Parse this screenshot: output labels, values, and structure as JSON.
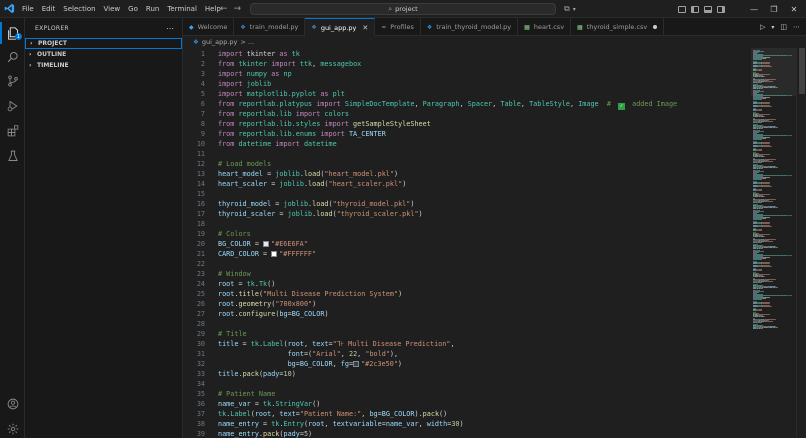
{
  "menu": [
    "File",
    "Edit",
    "Selection",
    "View",
    "Go",
    "Run",
    "Terminal",
    "Help"
  ],
  "search": {
    "text": "project"
  },
  "sidebar": {
    "title": "EXPLORER",
    "sections": [
      {
        "label": "PROJECT",
        "focused": true
      },
      {
        "label": "OUTLINE",
        "focused": false
      },
      {
        "label": "TIMELINE",
        "focused": false
      }
    ]
  },
  "tabs": [
    {
      "label": "Welcome",
      "icon": "vscode-icon",
      "color": "#3aa0f0",
      "active": false,
      "state": ""
    },
    {
      "label": "train_model.py",
      "icon": "python-icon",
      "color": "#3d8fd1",
      "active": false,
      "state": ""
    },
    {
      "label": "gui_app.py",
      "icon": "python-icon",
      "color": "#3d8fd1",
      "active": true,
      "state": "close"
    },
    {
      "label": "Profiles",
      "icon": "profiles-icon",
      "color": "#9d9d9d",
      "active": false,
      "state": ""
    },
    {
      "label": "train_thyroid_model.py",
      "icon": "python-icon",
      "color": "#3d8fd1",
      "active": false,
      "state": ""
    },
    {
      "label": "heart.csv",
      "icon": "csv-icon",
      "color": "#89d185",
      "active": false,
      "state": ""
    },
    {
      "label": "thyroid_simple.csv",
      "icon": "csv-icon",
      "color": "#89d185",
      "active": false,
      "state": "dirty"
    }
  ],
  "breadcrumb": {
    "file": "gui_app.py",
    "rest": "> ..."
  },
  "colors": {
    "accent": "#0078d4",
    "editor_bg": "#1f1f1f",
    "sidebar_bg": "#181818"
  },
  "code": [
    [
      [
        "k",
        "import"
      ],
      [
        "w",
        " tkinter "
      ],
      [
        "k",
        "as"
      ],
      [
        "t",
        " tk"
      ]
    ],
    [
      [
        "k",
        "from"
      ],
      [
        "t",
        " tkinter "
      ],
      [
        "k",
        "import"
      ],
      [
        "t",
        " ttk"
      ],
      [
        "p",
        ", "
      ],
      [
        "t",
        "messagebox"
      ]
    ],
    [
      [
        "k",
        "import"
      ],
      [
        "t",
        " numpy "
      ],
      [
        "k",
        "as"
      ],
      [
        "t",
        " np"
      ]
    ],
    [
      [
        "k",
        "import"
      ],
      [
        "t",
        " joblib"
      ]
    ],
    [
      [
        "k",
        "import"
      ],
      [
        "t",
        " matplotlib.pyplot "
      ],
      [
        "k",
        "as"
      ],
      [
        "t",
        " plt"
      ]
    ],
    [
      [
        "k",
        "from"
      ],
      [
        "t",
        " reportlab.platypus "
      ],
      [
        "k",
        "import"
      ],
      [
        "t",
        " SimpleDocTemplate"
      ],
      [
        "p",
        ", "
      ],
      [
        "t",
        "Paragraph"
      ],
      [
        "p",
        ", "
      ],
      [
        "t",
        "Spacer"
      ],
      [
        "p",
        ", "
      ],
      [
        "t",
        "Table"
      ],
      [
        "p",
        ", "
      ],
      [
        "t",
        "TableStyle"
      ],
      [
        "p",
        ", "
      ],
      [
        "t",
        "Image"
      ],
      [
        "c",
        "  # "
      ],
      [
        "chk",
        "✓"
      ],
      [
        "c",
        " added Image"
      ]
    ],
    [
      [
        "k",
        "from"
      ],
      [
        "t",
        " reportlab.lib "
      ],
      [
        "k",
        "import"
      ],
      [
        "t",
        " colors"
      ]
    ],
    [
      [
        "k",
        "from"
      ],
      [
        "t",
        " reportlab.lib.styles "
      ],
      [
        "k",
        "import"
      ],
      [
        "f",
        " getSampleStyleSheet"
      ]
    ],
    [
      [
        "k",
        "from"
      ],
      [
        "t",
        " reportlab.lib.enums "
      ],
      [
        "k",
        "import"
      ],
      [
        "v",
        " TA_CENTER"
      ]
    ],
    [
      [
        "k",
        "from"
      ],
      [
        "t",
        " datetime "
      ],
      [
        "k",
        "import"
      ],
      [
        "t",
        " datetime"
      ]
    ],
    [],
    [
      [
        "c",
        "# Load models"
      ]
    ],
    [
      [
        "v",
        "heart_model"
      ],
      [
        "p",
        " = "
      ],
      [
        "t",
        "joblib"
      ],
      [
        "p",
        "."
      ],
      [
        "f",
        "load"
      ],
      [
        "p",
        "("
      ],
      [
        "s",
        "\"heart_model.pkl\""
      ],
      [
        "p",
        ")"
      ]
    ],
    [
      [
        "v",
        "heart_scaler"
      ],
      [
        "p",
        " = "
      ],
      [
        "t",
        "joblib"
      ],
      [
        "p",
        "."
      ],
      [
        "f",
        "load"
      ],
      [
        "p",
        "("
      ],
      [
        "s",
        "\"heart_scaler.pkl\""
      ],
      [
        "p",
        ")"
      ]
    ],
    [],
    [
      [
        "v",
        "thyroid_model"
      ],
      [
        "p",
        " = "
      ],
      [
        "t",
        "joblib"
      ],
      [
        "p",
        "."
      ],
      [
        "f",
        "load"
      ],
      [
        "p",
        "("
      ],
      [
        "s",
        "\"thyroid_model.pkl\""
      ],
      [
        "p",
        ")"
      ]
    ],
    [
      [
        "v",
        "thyroid_scaler"
      ],
      [
        "p",
        " = "
      ],
      [
        "t",
        "joblib"
      ],
      [
        "p",
        "."
      ],
      [
        "f",
        "load"
      ],
      [
        "p",
        "("
      ],
      [
        "s",
        "\"thyroid_scaler.pkl\""
      ],
      [
        "p",
        ")"
      ]
    ],
    [],
    [
      [
        "c",
        "# Colors"
      ]
    ],
    [
      [
        "v",
        "BG_COLOR"
      ],
      [
        "p",
        " = "
      ],
      [
        "sw",
        "#E6E6FA"
      ],
      [
        "s",
        "\"#E6E6FA\""
      ]
    ],
    [
      [
        "v",
        "CARD_COLOR"
      ],
      [
        "p",
        " = "
      ],
      [
        "sw",
        "#FFFFFF"
      ],
      [
        "s",
        "\"#FFFFFF\""
      ]
    ],
    [],
    [
      [
        "c",
        "# Window"
      ]
    ],
    [
      [
        "v",
        "root"
      ],
      [
        "p",
        " = "
      ],
      [
        "t",
        "tk"
      ],
      [
        "p",
        "."
      ],
      [
        "t",
        "Tk"
      ],
      [
        "p",
        "()"
      ]
    ],
    [
      [
        "v",
        "root"
      ],
      [
        "p",
        "."
      ],
      [
        "f",
        "title"
      ],
      [
        "p",
        "("
      ],
      [
        "s",
        "\"Multi Disease Prediction System\""
      ],
      [
        "p",
        ")"
      ]
    ],
    [
      [
        "v",
        "root"
      ],
      [
        "p",
        "."
      ],
      [
        "f",
        "geometry"
      ],
      [
        "p",
        "("
      ],
      [
        "s",
        "\"700x800\""
      ],
      [
        "p",
        ")"
      ]
    ],
    [
      [
        "v",
        "root"
      ],
      [
        "p",
        "."
      ],
      [
        "f",
        "configure"
      ],
      [
        "p",
        "("
      ],
      [
        "v",
        "bg"
      ],
      [
        "p",
        "="
      ],
      [
        "v",
        "BG_COLOR"
      ],
      [
        "p",
        ")"
      ]
    ],
    [],
    [
      [
        "c",
        "# Title"
      ]
    ],
    [
      [
        "v",
        "title"
      ],
      [
        "p",
        " = "
      ],
      [
        "t",
        "tk"
      ],
      [
        "p",
        "."
      ],
      [
        "t",
        "Label"
      ],
      [
        "p",
        "("
      ],
      [
        "v",
        "root"
      ],
      [
        "p",
        ", "
      ],
      [
        "v",
        "text"
      ],
      [
        "p",
        "="
      ],
      [
        "s",
        "\"⅂⊦ Multi Disease Prediction\""
      ],
      [
        "p",
        ","
      ]
    ],
    [
      [
        "w",
        "                 "
      ],
      [
        "v",
        "font"
      ],
      [
        "p",
        "=("
      ],
      [
        "s",
        "\"Arial\""
      ],
      [
        "p",
        ", "
      ],
      [
        "n",
        "22"
      ],
      [
        "p",
        ", "
      ],
      [
        "s",
        "\"bold\""
      ],
      [
        "p",
        "),"
      ]
    ],
    [
      [
        "w",
        "                 "
      ],
      [
        "v",
        "bg"
      ],
      [
        "p",
        "="
      ],
      [
        "v",
        "BG_COLOR"
      ],
      [
        "p",
        ", "
      ],
      [
        "v",
        "fg"
      ],
      [
        "p",
        "="
      ],
      [
        "sw",
        "#2c3e50"
      ],
      [
        "s",
        "\"#2c3e50\""
      ],
      [
        "p",
        ")"
      ]
    ],
    [
      [
        "v",
        "title"
      ],
      [
        "p",
        "."
      ],
      [
        "f",
        "pack"
      ],
      [
        "p",
        "("
      ],
      [
        "v",
        "pady"
      ],
      [
        "p",
        "="
      ],
      [
        "n",
        "10"
      ],
      [
        "p",
        ")"
      ]
    ],
    [],
    [
      [
        "c",
        "# Patient Name"
      ]
    ],
    [
      [
        "v",
        "name_var"
      ],
      [
        "p",
        " = "
      ],
      [
        "t",
        "tk"
      ],
      [
        "p",
        "."
      ],
      [
        "t",
        "StringVar"
      ],
      [
        "p",
        "()"
      ]
    ],
    [
      [
        "t",
        "tk"
      ],
      [
        "p",
        "."
      ],
      [
        "t",
        "Label"
      ],
      [
        "p",
        "("
      ],
      [
        "v",
        "root"
      ],
      [
        "p",
        ", "
      ],
      [
        "v",
        "text"
      ],
      [
        "p",
        "="
      ],
      [
        "s",
        "\"Patient Name:\""
      ],
      [
        "p",
        ", "
      ],
      [
        "v",
        "bg"
      ],
      [
        "p",
        "="
      ],
      [
        "v",
        "BG_COLOR"
      ],
      [
        "p",
        ")."
      ],
      [
        "f",
        "pack"
      ],
      [
        "p",
        "()"
      ]
    ],
    [
      [
        "v",
        "name_entry"
      ],
      [
        "p",
        " = "
      ],
      [
        "t",
        "tk"
      ],
      [
        "p",
        "."
      ],
      [
        "t",
        "Entry"
      ],
      [
        "p",
        "("
      ],
      [
        "v",
        "root"
      ],
      [
        "p",
        ", "
      ],
      [
        "v",
        "textvariable"
      ],
      [
        "p",
        "="
      ],
      [
        "v",
        "name_var"
      ],
      [
        "p",
        ", "
      ],
      [
        "v",
        "width"
      ],
      [
        "p",
        "="
      ],
      [
        "n",
        "30"
      ],
      [
        "p",
        ")"
      ]
    ],
    [
      [
        "v",
        "name_entry"
      ],
      [
        "p",
        "."
      ],
      [
        "f",
        "pack"
      ],
      [
        "p",
        "("
      ],
      [
        "v",
        "pady"
      ],
      [
        "p",
        "="
      ],
      [
        "n",
        "5"
      ],
      [
        "p",
        ")"
      ]
    ]
  ]
}
